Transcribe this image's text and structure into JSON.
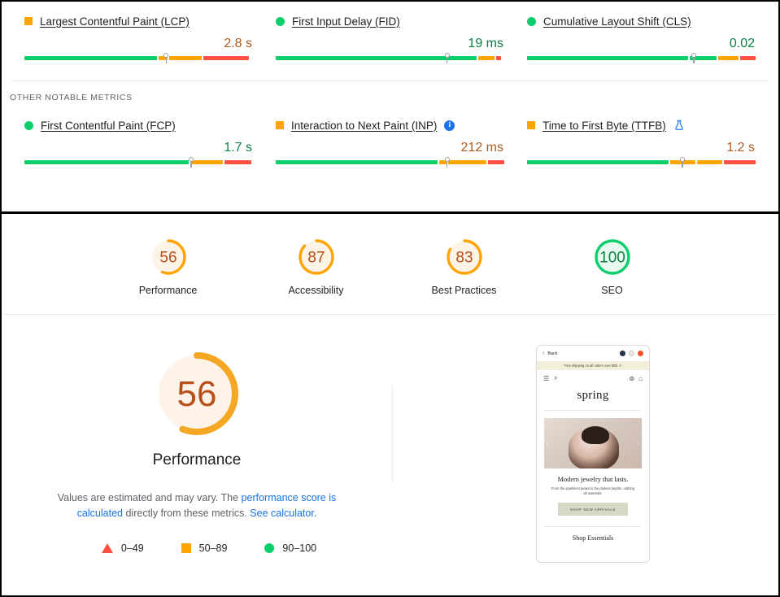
{
  "field_metrics": {
    "core": [
      {
        "icon": "orange-square",
        "name": "Largest Contentful Paint (LCP)",
        "value": "2.8 s",
        "status": "average",
        "segments": [
          58,
          12,
          26
        ],
        "marker": 62
      },
      {
        "icon": "green-circle",
        "name": "First Input Delay (FID)",
        "value": "19 ms",
        "status": "good",
        "segments": [
          88,
          8,
          2
        ],
        "marker": 75
      },
      {
        "icon": "green-circle",
        "name": "Cumulative Layout Shift (CLS)",
        "value": "0.02",
        "status": "good",
        "segments": [
          72,
          14,
          10
        ],
        "marker": 73
      }
    ],
    "other_label": "OTHER NOTABLE METRICS",
    "other": [
      {
        "icon": "green-circle",
        "name": "First Contentful Paint (FCP)",
        "value": "1.7 s",
        "status": "good",
        "segments": [
          72,
          14,
          12
        ],
        "marker": 73
      },
      {
        "icon": "orange-square",
        "name": "Interaction to Next Paint (INP)",
        "badge": "info-icon",
        "value": "212 ms",
        "status": "average",
        "segments": [
          71,
          4,
          18,
          7
        ],
        "marker": 75
      },
      {
        "icon": "orange-square",
        "name": "Time to First Byte (TTFB)",
        "badge": "flask-icon",
        "value": "1.2 s",
        "status": "average",
        "segments": [
          62,
          12,
          12,
          14
        ],
        "marker": 68
      }
    ]
  },
  "lighthouse_scores": [
    {
      "score": 56,
      "label": "Performance",
      "status": "average",
      "color": "#ffa400"
    },
    {
      "score": 87,
      "label": "Accessibility",
      "status": "average",
      "color": "#ffa400"
    },
    {
      "score": 83,
      "label": "Best Practices",
      "status": "average",
      "color": "#ffa400"
    },
    {
      "score": 100,
      "label": "SEO",
      "status": "good",
      "color": "#0cce6b"
    }
  ],
  "performance_detail": {
    "score": 56,
    "label": "Performance",
    "description_part1": "Values are estimated and may vary. The ",
    "link_text": "performance score is calculated",
    "description_part2": " directly from these metrics. ",
    "link_text2": "See calculator.",
    "legend": [
      {
        "shape": "triangle",
        "range": "0–49",
        "color": "#ff4e42"
      },
      {
        "shape": "square",
        "range": "50–89",
        "color": "#ffa400"
      },
      {
        "shape": "circle",
        "range": "90–100",
        "color": "#0cce6b"
      }
    ]
  },
  "screenshot_preview": {
    "back_label": "Back",
    "banner_text": "Free shipping on all orders over $50",
    "logo": "spring",
    "heading": "Modern jewelry that lasts.",
    "subheading": "From the sparkliest peaks to the darkest depths, utilizing all materials.",
    "cta": "SHOP NEW ARRIVALS",
    "footer_heading": "Shop Essentials"
  }
}
